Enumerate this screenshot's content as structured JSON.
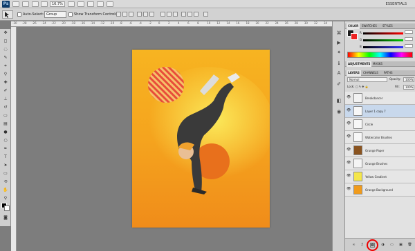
{
  "appbar": {
    "zoom": "16.7%",
    "workspace": "ESSENTIALS",
    "logo": "Ps"
  },
  "options": {
    "auto_select_label": "Auto-Select:",
    "auto_select_value": "Group",
    "transform_label": "Show Transform Controls"
  },
  "ruler": {
    "top": [
      "-30",
      "-28",
      "-26",
      "-24",
      "-22",
      "-20",
      "-18",
      "-16",
      "-14",
      "-12",
      "-10",
      "-8",
      "-6",
      "-4",
      "-2",
      "0",
      "2",
      "4",
      "6",
      "8",
      "10",
      "12",
      "14",
      "16",
      "18",
      "20",
      "22",
      "24",
      "26",
      "28",
      "30",
      "32",
      "34"
    ]
  },
  "color_panel": {
    "tabs": [
      "COLOR",
      "SWATCHES",
      "STYLES"
    ],
    "r_label": "R",
    "g_label": "G",
    "b_label": "B",
    "r_value": "",
    "g_value": "",
    "b_value": ""
  },
  "adjust_panel": {
    "tabs": [
      "ADJUSTMENTS",
      "MASKS"
    ]
  },
  "layers_panel": {
    "tabs": [
      "LAYERS",
      "CHANNELS",
      "PATHS"
    ],
    "blend_mode": "Normal",
    "opacity_label": "Opacity:",
    "opacity_value": "100%",
    "lock_label": "Lock:",
    "fill_label": "Fill:",
    "fill_value": "100%",
    "layers": [
      {
        "name": "Breakdancer",
        "thumb_color": "#f2f2f2",
        "selected": false
      },
      {
        "name": "Layer 1 copy 7",
        "thumb_color": "#f7f7f7",
        "selected": true
      },
      {
        "name": "Circle",
        "thumb_color": "#f7f7f7",
        "selected": false
      },
      {
        "name": "Watercolor Brushes",
        "thumb_color": "#f7f7f7",
        "selected": false
      },
      {
        "name": "Grunge Paper",
        "thumb_color": "#8a5420",
        "selected": false
      },
      {
        "name": "Grunge Brushes",
        "thumb_color": "#f4f4f4",
        "selected": false
      },
      {
        "name": "Yellow Gradient",
        "thumb_color": "#f4e64c",
        "selected": false
      },
      {
        "name": "Orange Background",
        "thumb_color": "#f09b1c",
        "selected": false
      }
    ]
  },
  "colors": {
    "accent_selected": "#c8d8ec",
    "highlight_circle": "#e00000",
    "art_bg": "#f4a21f"
  }
}
